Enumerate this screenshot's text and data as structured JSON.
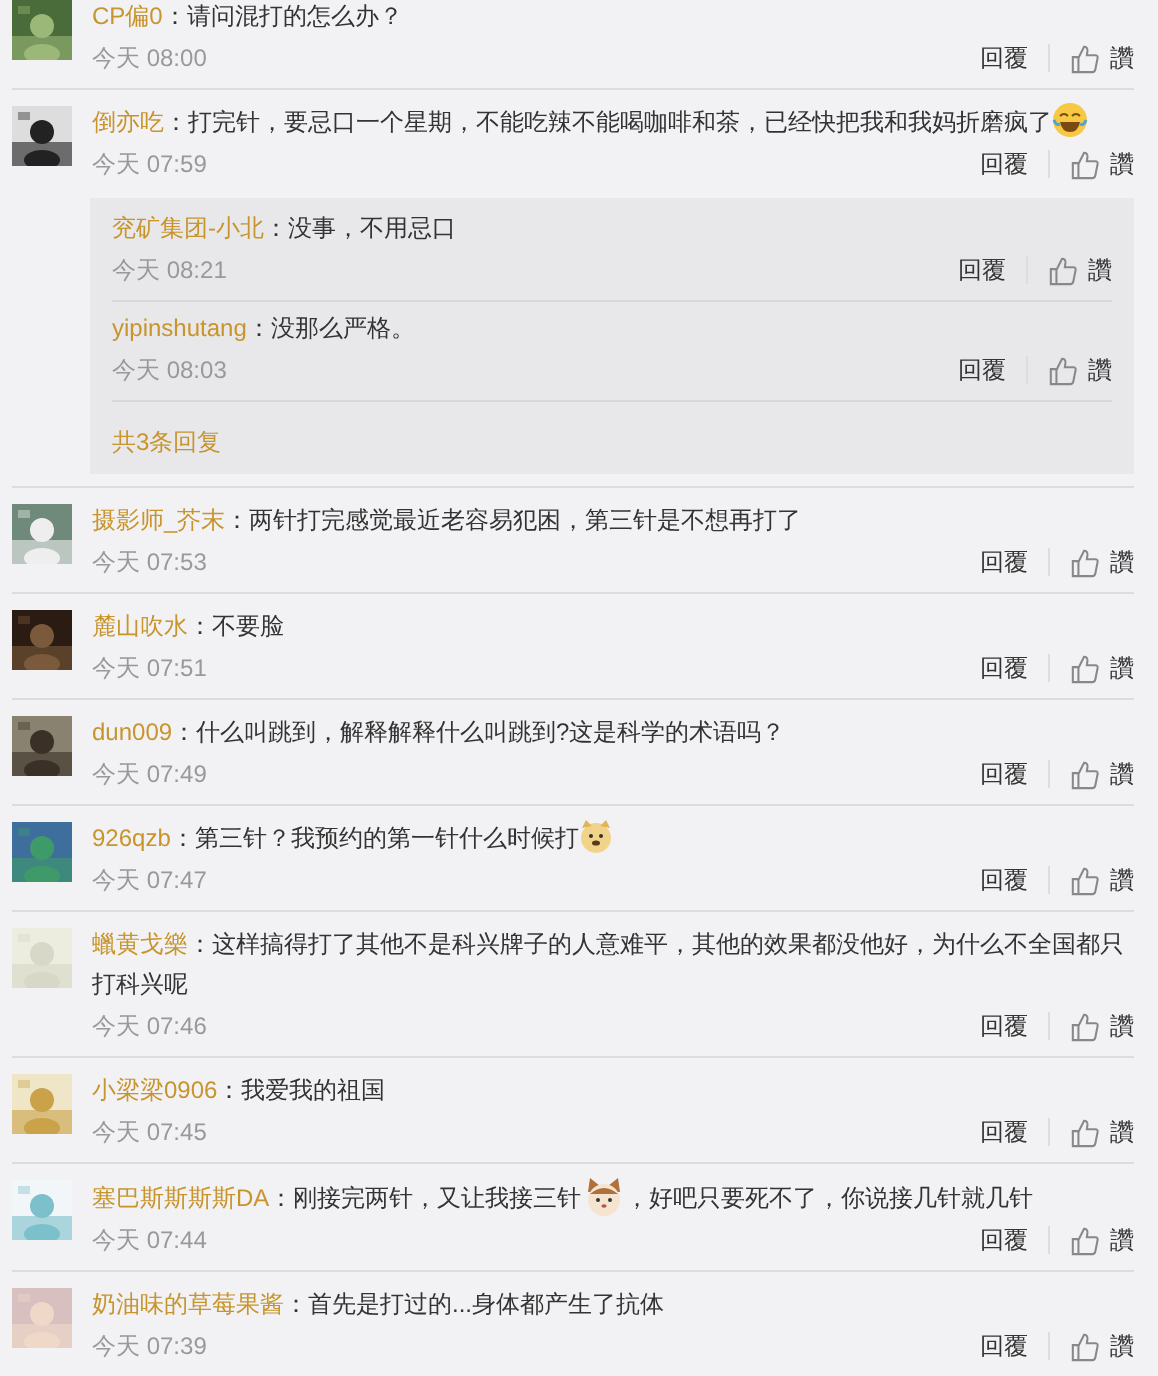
{
  "comments": [
    {
      "user": "CP偏0",
      "segments": [
        {
          "kind": "text",
          "text": "：请问混打的怎么办？"
        }
      ],
      "time": "今天 08:00",
      "reply_label": "回覆",
      "like_label": "讚"
    },
    {
      "user": "倒亦吃",
      "segments": [
        {
          "kind": "text",
          "text": "：打完针，要忌口一个星期，不能吃辣不能喝咖啡和茶，已经快把我和我妈折磨疯了"
        },
        {
          "kind": "laugh"
        }
      ],
      "time": "今天 07:59",
      "reply_label": "回覆",
      "like_label": "讚",
      "replies": [
        {
          "user": "兖矿集团-小北",
          "text": "：没事，不用忌口",
          "time": "今天 08:21",
          "reply_label": "回覆",
          "like_label": "讚"
        },
        {
          "user": "yipinshutang",
          "text": "：没那么严格。",
          "time": "今天 08:03",
          "reply_label": "回覆",
          "like_label": "讚"
        }
      ],
      "more_replies": "共3条回复"
    },
    {
      "user": "摄影师_芥末",
      "segments": [
        {
          "kind": "text",
          "text": "：两针打完感觉最近老容易犯困，第三针是不想再打了"
        }
      ],
      "time": "今天 07:53",
      "reply_label": "回覆",
      "like_label": "讚"
    },
    {
      "user": "麓山吹水",
      "segments": [
        {
          "kind": "text",
          "text": "：不要脸"
        }
      ],
      "time": "今天 07:51",
      "reply_label": "回覆",
      "like_label": "讚"
    },
    {
      "user": "dun009",
      "segments": [
        {
          "kind": "text",
          "text": "：什么叫跳到，解释解释什么叫跳到?这是科学的术语吗？"
        }
      ],
      "time": "今天 07:49",
      "reply_label": "回覆",
      "like_label": "讚"
    },
    {
      "user": "926qzb",
      "segments": [
        {
          "kind": "text",
          "text": "：第三针？我预约的第一针什么时候打"
        },
        {
          "kind": "dog"
        }
      ],
      "time": "今天 07:47",
      "reply_label": "回覆",
      "like_label": "讚"
    },
    {
      "user": "蠟黄戈樂",
      "segments": [
        {
          "kind": "text",
          "text": "：这样搞得打了其他不是科兴牌子的人意难平，其他的效果都没他好，为什么不全国都只打科兴呢"
        }
      ],
      "time": "今天 07:46",
      "reply_label": "回覆",
      "like_label": "讚"
    },
    {
      "user": "小梁梁0906",
      "segments": [
        {
          "kind": "text",
          "text": "：我爱我的祖国"
        }
      ],
      "time": "今天 07:45",
      "reply_label": "回覆",
      "like_label": "讚"
    },
    {
      "user": "塞巴斯斯斯斯DA",
      "segments": [
        {
          "kind": "text",
          "text": "：刚接完两针，又让我接三针"
        },
        {
          "kind": "cat"
        },
        {
          "kind": "text",
          "text": "，好吧只要死不了，你说接几针就几针"
        }
      ],
      "time": "今天 07:44",
      "reply_label": "回覆",
      "like_label": "讚"
    },
    {
      "user": "奶油味的草莓果酱",
      "segments": [
        {
          "kind": "text",
          "text": "：首先是打过的...身体都产生了抗体"
        }
      ],
      "time": "今天 07:39",
      "reply_label": "回覆",
      "like_label": "讚"
    }
  ]
}
